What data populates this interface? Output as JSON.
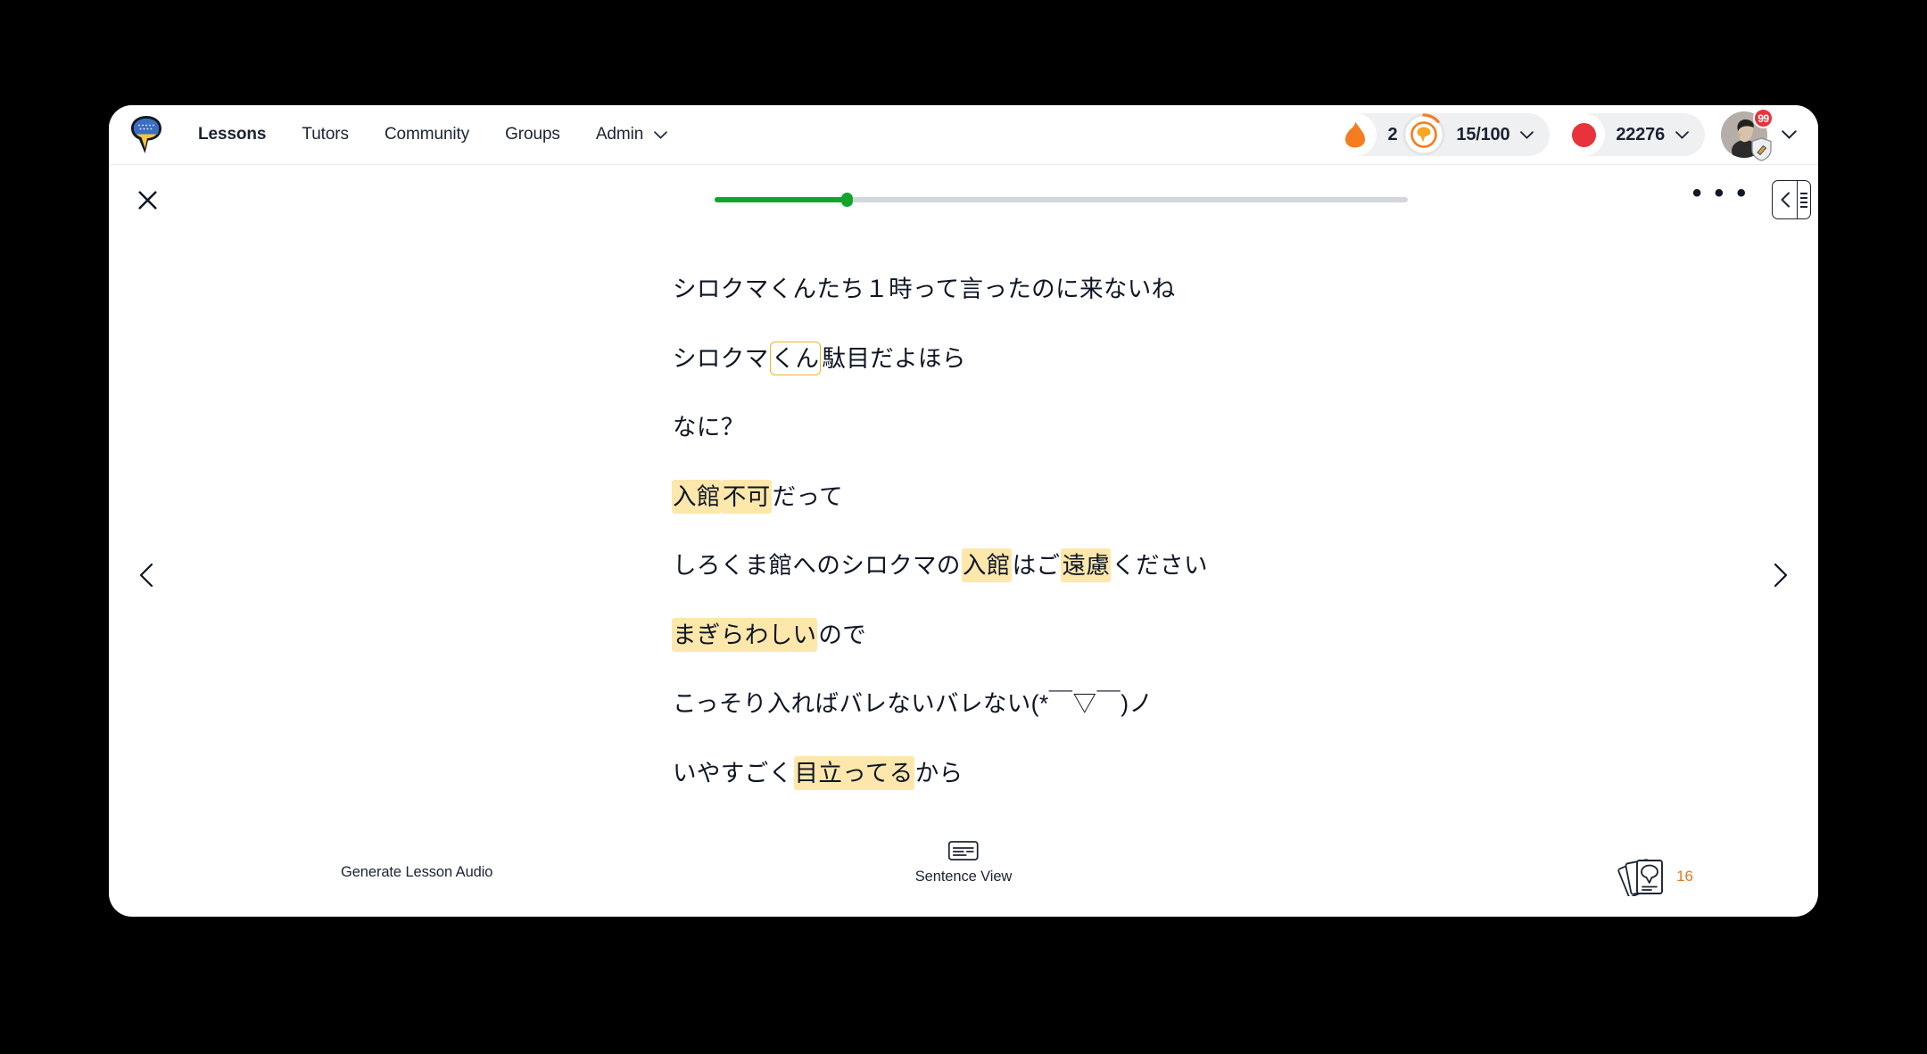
{
  "nav": {
    "logo_icon": "speech-bubble-pin-logo",
    "links": [
      {
        "label": "Lessons",
        "active": true,
        "caret": false
      },
      {
        "label": "Tutors",
        "active": false,
        "caret": false
      },
      {
        "label": "Community",
        "active": false,
        "caret": false
      },
      {
        "label": "Groups",
        "active": false,
        "caret": false
      },
      {
        "label": "Admin",
        "active": false,
        "caret": true
      }
    ],
    "stats": {
      "streak": {
        "icon": "flame-icon",
        "value": "2"
      },
      "coins": {
        "icon": "coin-progress-icon",
        "value": "15/100",
        "caret": true
      },
      "points": {
        "icon": "japan-flag-icon",
        "value": "22276",
        "caret": true
      }
    },
    "avatar": {
      "icon": "avatar",
      "notification_badge": "99",
      "shield_icon": "shield-badge-icon",
      "caret": true
    }
  },
  "lesson_header": {
    "close_icon": "close-icon",
    "progress_percent": 19,
    "more_menu_label": "• • •",
    "panel_toggle_icon": "collapse-panel-icon"
  },
  "navigation": {
    "prev_icon": "chevron-left-icon",
    "next_icon": "chevron-right-icon"
  },
  "lesson": {
    "lines": [
      {
        "segments": [
          {
            "text": "シロクマくんたち１時って言ったのに来ないね",
            "style": "plain"
          }
        ]
      },
      {
        "segments": [
          {
            "text": "シロクマ",
            "style": "plain"
          },
          {
            "text": "くん",
            "style": "boxed"
          },
          {
            "text": "駄目だよほら",
            "style": "plain"
          }
        ]
      },
      {
        "segments": [
          {
            "text": "なに？",
            "style": "plain"
          }
        ]
      },
      {
        "segments": [
          {
            "text": "入館",
            "style": "highlight"
          },
          {
            "text": "不可",
            "style": "highlight"
          },
          {
            "text": "だって",
            "style": "plain"
          }
        ]
      },
      {
        "segments": [
          {
            "text": "しろくま館へのシロクマの",
            "style": "plain"
          },
          {
            "text": "入館",
            "style": "highlight"
          },
          {
            "text": "はご",
            "style": "plain"
          },
          {
            "text": "遠慮",
            "style": "highlight"
          },
          {
            "text": "ください",
            "style": "plain"
          }
        ]
      },
      {
        "segments": [
          {
            "text": "まぎらわしい",
            "style": "highlight"
          },
          {
            "text": "ので",
            "style": "plain"
          }
        ]
      },
      {
        "segments": [
          {
            "text": "こっそり入ればバレないバレない(*￣▽￣)ノ",
            "style": "plain"
          }
        ]
      },
      {
        "segments": [
          {
            "text": "いやすごく",
            "style": "plain"
          },
          {
            "text": "目立ってる",
            "style": "highlight"
          },
          {
            "text": "から",
            "style": "plain"
          }
        ]
      }
    ]
  },
  "bottom_bar": {
    "generate_audio_label": "Generate Lesson Audio",
    "sentence_view": {
      "icon": "caption-icon",
      "label": "Sentence View"
    },
    "flashcards": {
      "icon": "flashcards-icon",
      "count": "16"
    }
  },
  "colors": {
    "highlight": "#fde7ab",
    "boxed_border": "#f0b429",
    "progress_fill": "#12a52c",
    "progress_track": "#d3d6dc",
    "badge_red": "#e8333a",
    "flame_orange": "#f57c20",
    "count_orange": "#e07a1f",
    "text": "#1b2333"
  }
}
